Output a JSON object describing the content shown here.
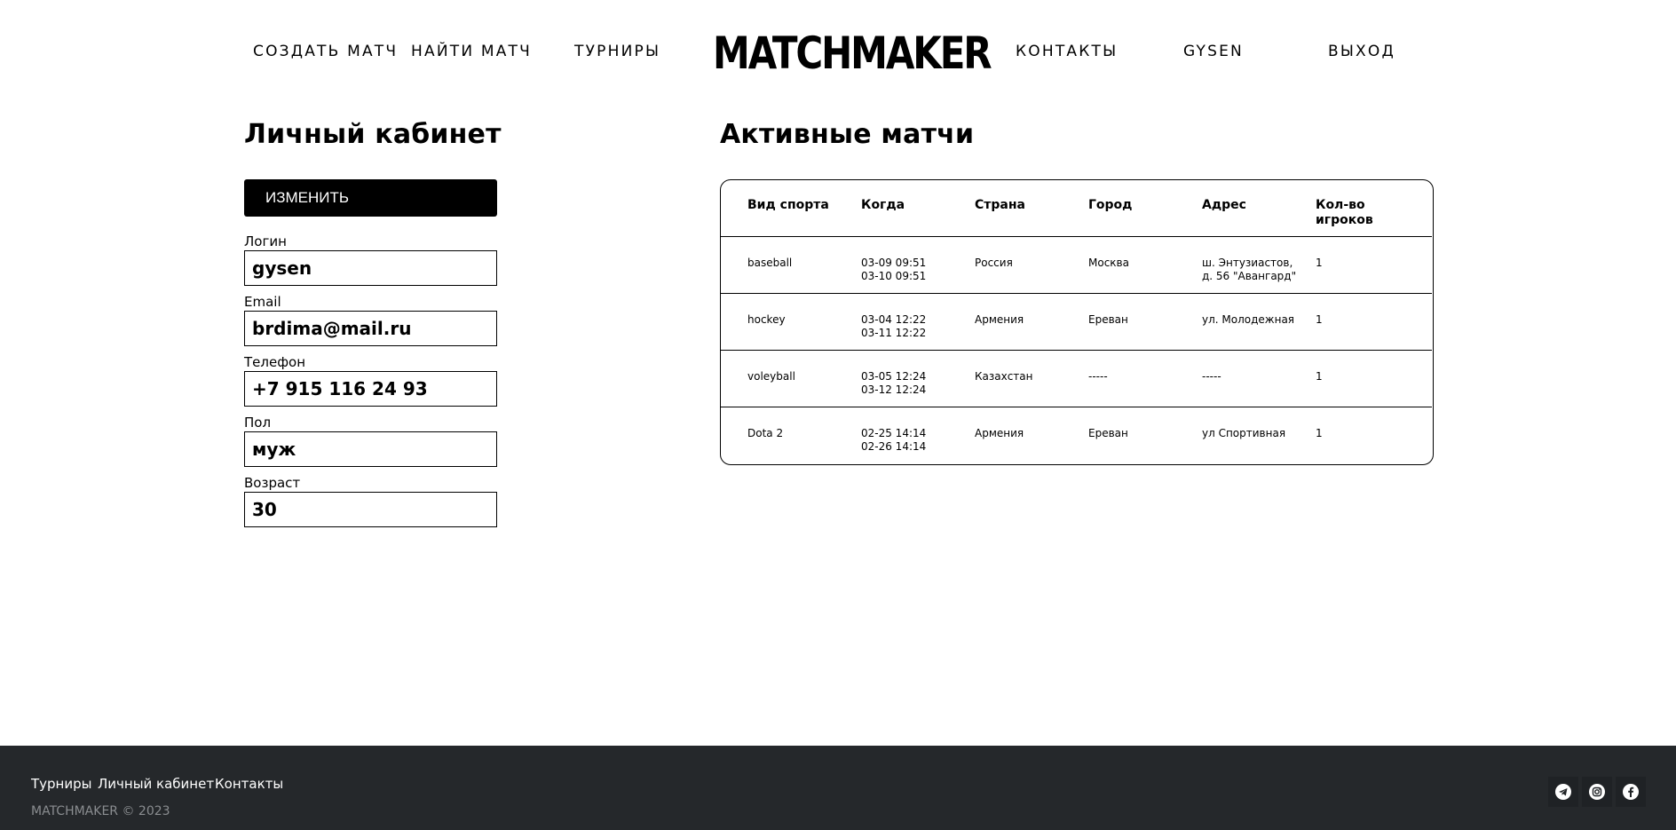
{
  "header": {
    "logo": "MATCHMAKER",
    "nav": {
      "create_match": "СОЗДАТЬ МАТЧ",
      "find_match": "НАЙТИ МАТЧ",
      "tournaments": "ТУРНИРЫ",
      "contacts": "КОНТАКТЫ",
      "user": "GYSEN",
      "logout": "ВЫХОД"
    }
  },
  "profile": {
    "title": "Личный кабинет",
    "edit_label": "ИЗМЕНИТЬ",
    "fields": [
      {
        "label": "Логин",
        "value": "gysen"
      },
      {
        "label": "Email",
        "value": "brdima@mail.ru"
      },
      {
        "label": "Телефон",
        "value": "+7 915 116 24 93"
      },
      {
        "label": "Пол",
        "value": "муж"
      },
      {
        "label": "Возраст",
        "value": "30"
      }
    ]
  },
  "matches": {
    "title": "Активные матчи",
    "columns": [
      "Вид спорта",
      "Когда",
      "Страна",
      "Город",
      "Адрес",
      "Кол-во\nигроков"
    ],
    "rows": [
      [
        "baseball",
        "03-09 09:51\n03-10 09:51",
        "Россия",
        "Москва",
        "ш. Энтузиастов,\nд. 56 \"Авангард\"",
        "1"
      ],
      [
        "hockey",
        "03-04 12:22\n03-11 12:22",
        "Армения",
        "Ереван",
        "ул. Молодежная",
        "1"
      ],
      [
        "voleyball",
        "03-05 12:24\n03-12 12:24",
        "Казахстан",
        "-----",
        "-----",
        "1"
      ],
      [
        "Dota 2",
        "02-25 14:14\n02-26 14:14",
        "Армения",
        "Ереван",
        "ул Спортивная",
        "1"
      ]
    ]
  },
  "footer": {
    "links": {
      "tournaments": "Турниры",
      "cabinet": "Личный кабинет",
      "contacts": "Контакты"
    },
    "copyright": "MATCHMAKER © 2023",
    "social_icons": [
      "telegram-icon",
      "instagram-icon",
      "facebook-icon"
    ]
  },
  "colors": {
    "footer_bg": "#25282b",
    "button_bg": "#000000",
    "copyright_text": "#8a8d90"
  }
}
